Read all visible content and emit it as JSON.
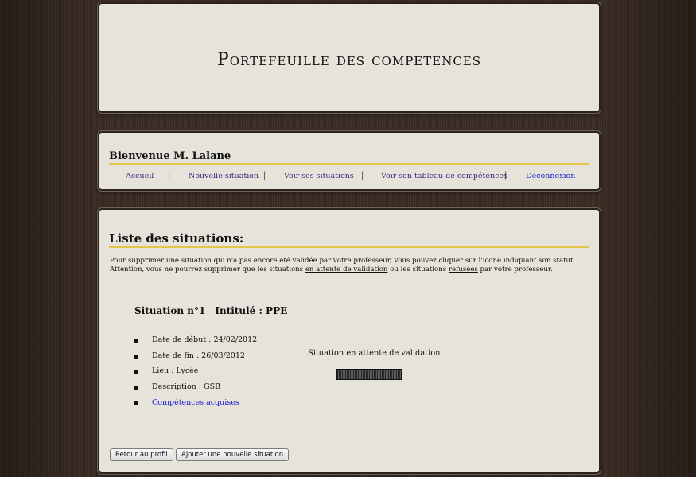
{
  "header": {
    "title": "Portefeuille des competences"
  },
  "welcome": {
    "text": "Bienvenue M. Lalane"
  },
  "menu": {
    "items": [
      {
        "label": "Accueil"
      },
      {
        "label": "Nouvelle situation"
      },
      {
        "label": "Voir ses situations"
      },
      {
        "label": "Voir son tableau de compétences"
      },
      {
        "label": "Déconnexion"
      }
    ],
    "separator": "|"
  },
  "main": {
    "title": "Liste des situations:",
    "intro": {
      "line1": "Pour supprimer une situation qui n'a pas encore été validée par votre professeur, vous pouvez cliquer sur l'icone indiquant son statut.",
      "line2_a": "Attention, vous ne pourrez supprimer que les situations ",
      "line2_b": "en attente de validation",
      "line2_c": " ou les situations ",
      "line2_d": "refusées",
      "line2_e": " par votre professeur."
    },
    "situation": {
      "number": "Situation n°1",
      "intitule": "Intitulé : PPE",
      "date_debut_label": "Date de début :",
      "date_debut": "24/02/2012",
      "date_fin_label": "Date de fin :",
      "date_fin": "26/03/2012",
      "lieu_label": "Lieu :",
      "lieu": "Lycée",
      "description_label": "Description :",
      "description": "GSB",
      "competences_link": "Compétences acquises",
      "status_text": "Situation en attente de validation",
      "status_icon": "status-pending-icon"
    },
    "buttons": {
      "back": "Retour au profil",
      "add": "Ajouter une nouvelle situation"
    }
  },
  "colors": {
    "accent_underline": "#e2c64a",
    "link": "#1a1ad6",
    "panel": "#e6e3da"
  }
}
